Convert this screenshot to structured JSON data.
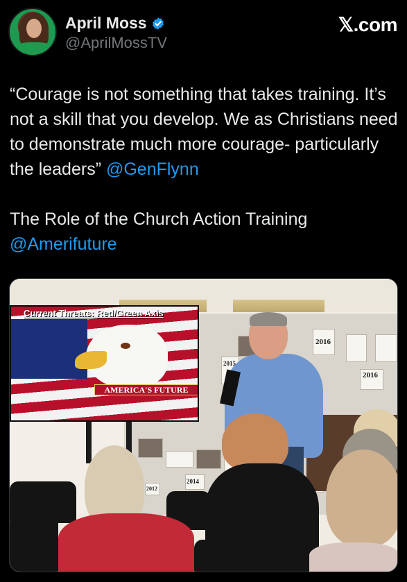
{
  "header": {
    "display_name": "April Moss",
    "handle": "@AprilMossTV",
    "brand": "𝕏.com",
    "verified_icon": "verified-badge-icon",
    "colors": {
      "verified": "#1d9bf0",
      "mention": "#1d9bf0",
      "secondary": "#71767b"
    }
  },
  "tweet": {
    "quote": "“Courage is not something that takes training. It’s not a skill that you develop. We as Christians need to demonstrate much more courage- particularly the leaders” ",
    "quote_mention": "@GenFlynn",
    "line2": "The Role of the Church Action Training",
    "line2_mention": "@Amerifuture"
  },
  "photo": {
    "tv_title": "Current Threats: Red/Green Axis",
    "tv_banner": "AMERICA'S FUTURE",
    "board_labels": [
      "2016",
      "2015",
      "2016",
      "2014",
      "2016",
      "2012"
    ]
  }
}
